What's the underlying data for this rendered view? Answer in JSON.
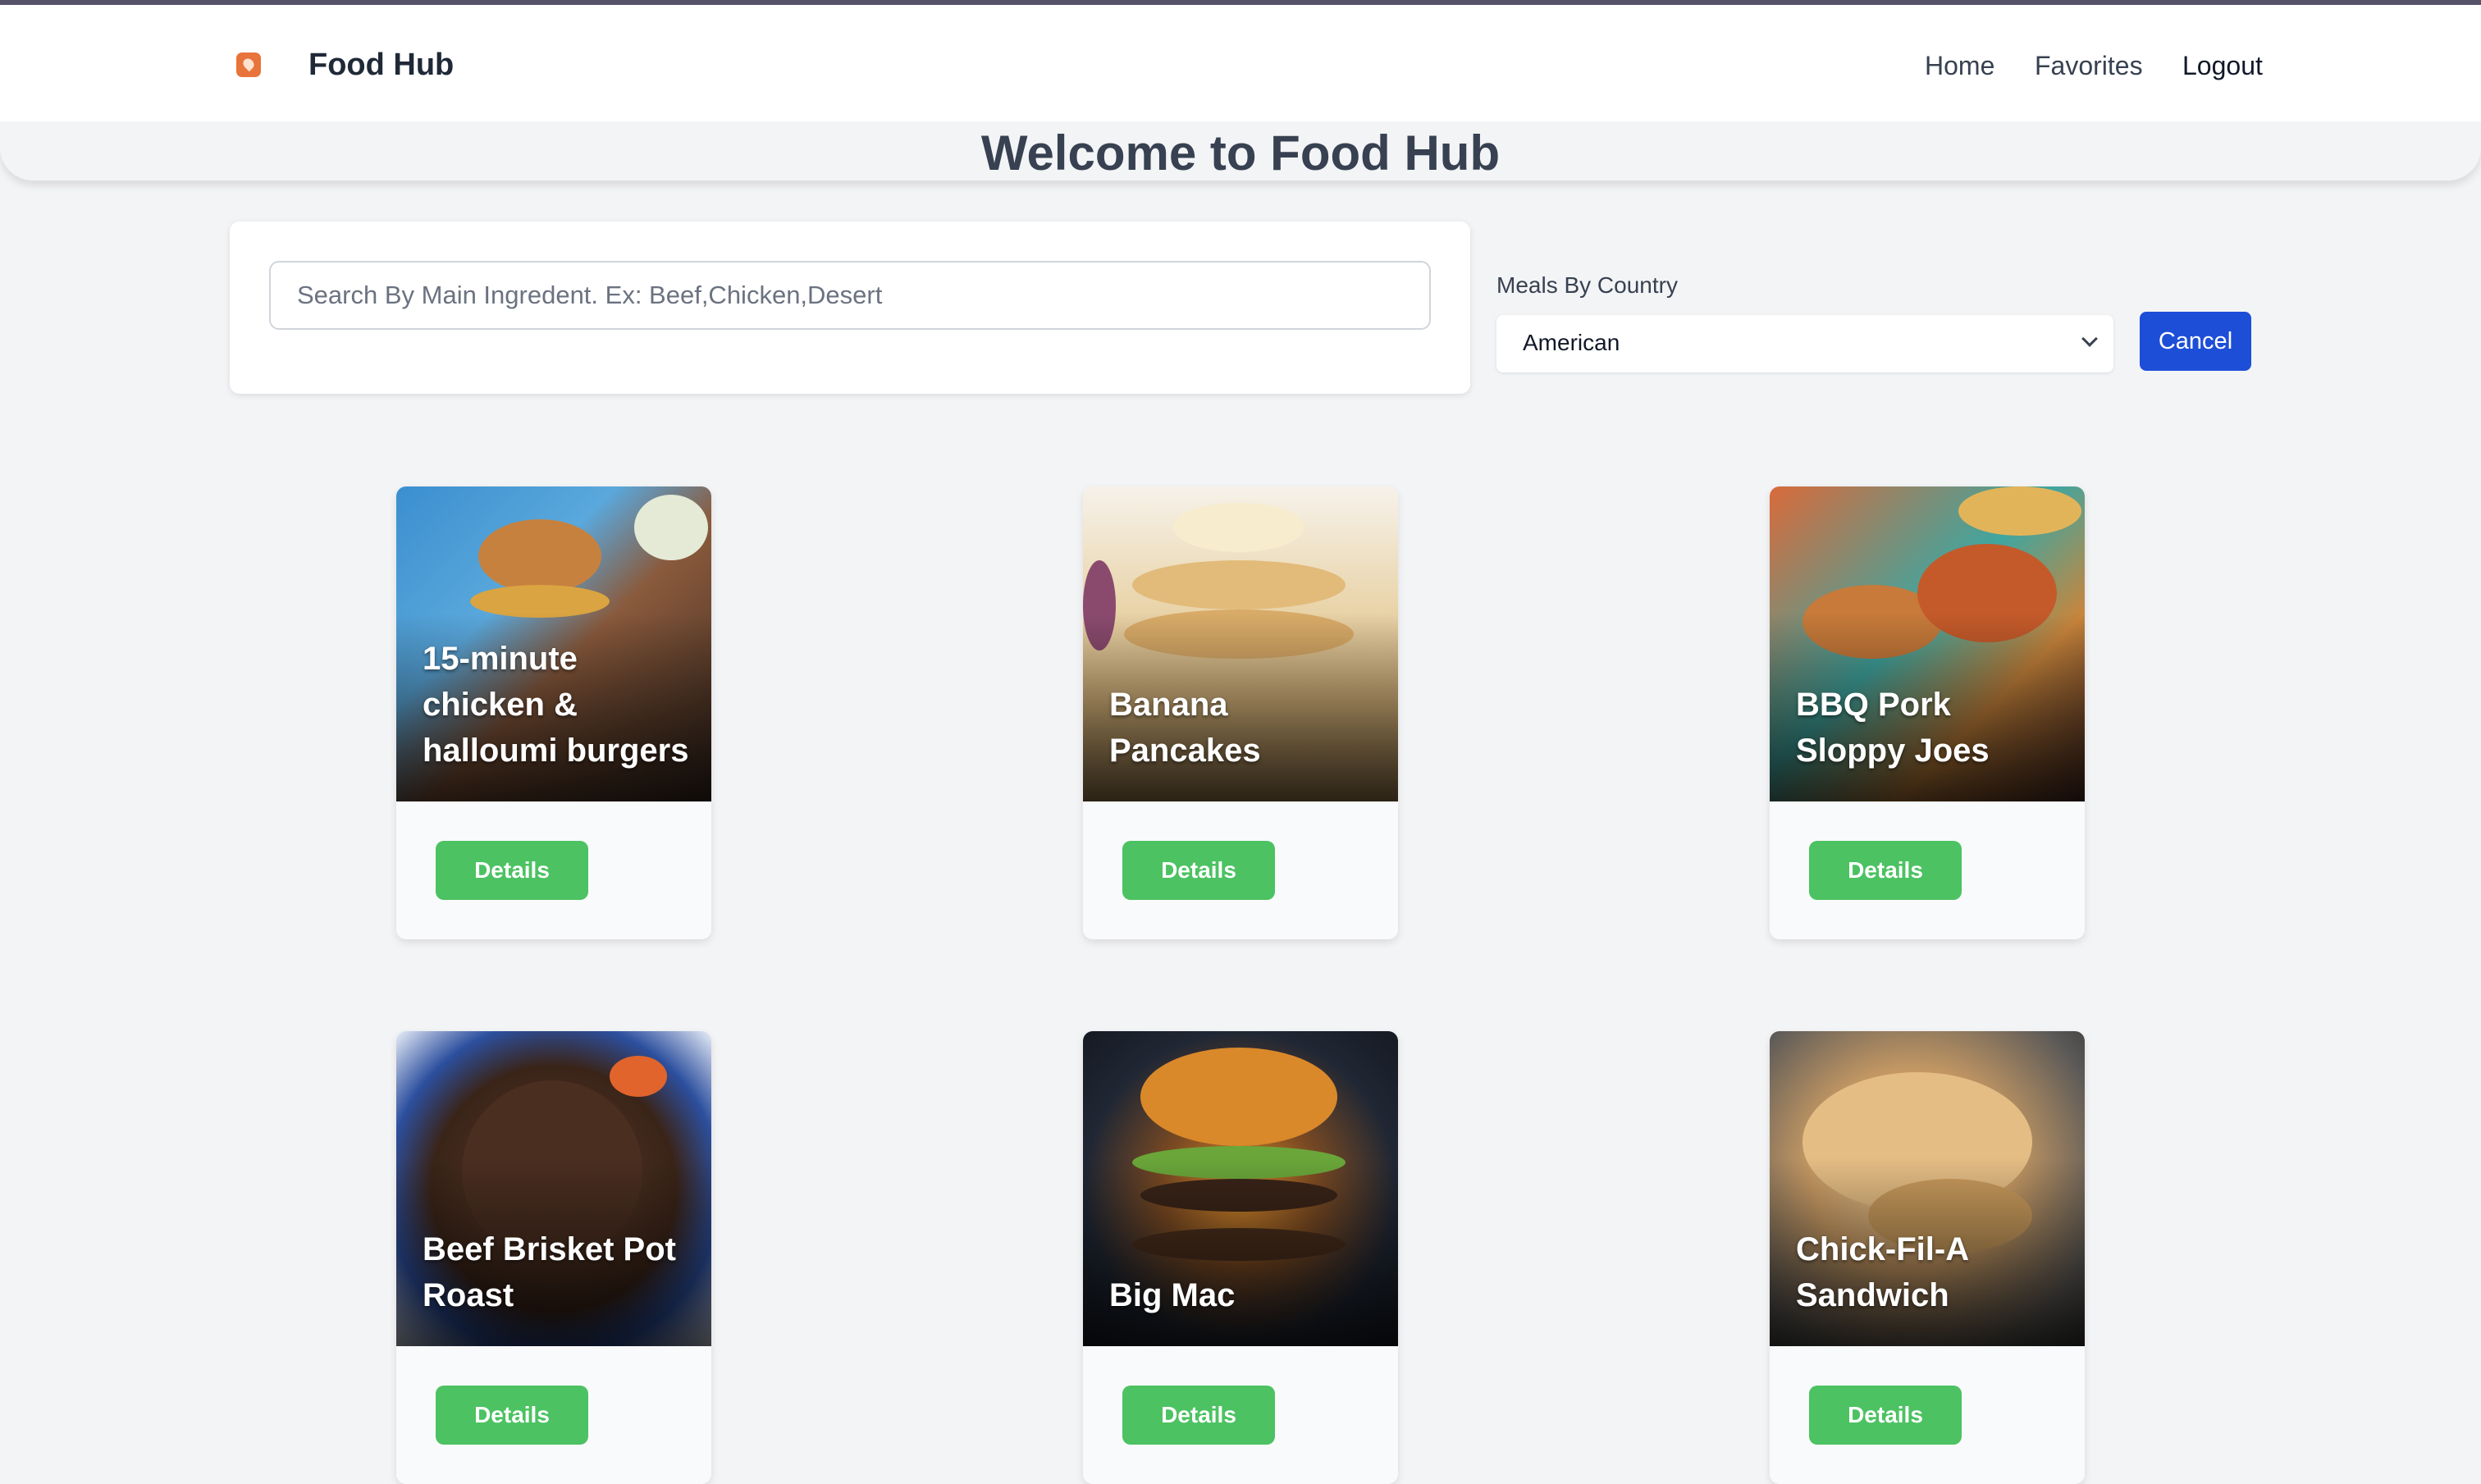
{
  "app": {
    "brand": "Food Hub",
    "hero_title": "Welcome to Food Hub"
  },
  "nav": {
    "home": "Home",
    "favorites": "Favorites",
    "logout": "Logout"
  },
  "search": {
    "placeholder": "Search By Main Ingredent. Ex: Beef,Chicken,Desert",
    "value": ""
  },
  "filter": {
    "label": "Meals By Country",
    "selected": "American",
    "cancel_label": "Cancel"
  },
  "meals": [
    {
      "name": "15-minute chicken & halloumi burgers",
      "button": "Details"
    },
    {
      "name": "Banana Pancakes",
      "button": "Details"
    },
    {
      "name": "BBQ Pork Sloppy Joes",
      "button": "Details"
    },
    {
      "name": "Beef Brisket Pot Roast",
      "button": "Details"
    },
    {
      "name": "Big Mac",
      "button": "Details"
    },
    {
      "name": "Chick-Fil-A Sandwich",
      "button": "Details"
    }
  ],
  "colors": {
    "accent_blue": "#1d4ed8",
    "details_green": "#4cc262",
    "logo_orange": "#e8743b"
  }
}
